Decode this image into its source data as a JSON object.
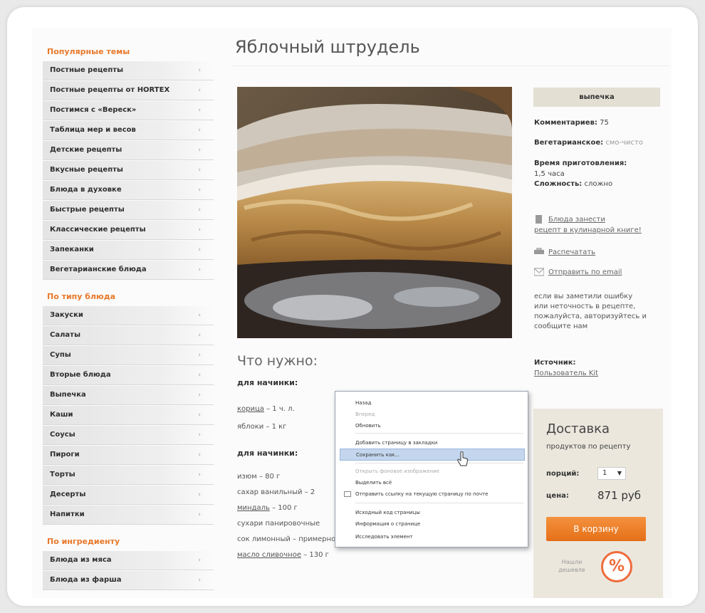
{
  "page": {
    "title": "Яблочный штрудель"
  },
  "sidebar": {
    "popular_heading": "Популярные темы",
    "popular_items": [
      "Постные рецепты",
      "Постные рецепты от HORTEX",
      "Постимся с «Вереск»",
      "Таблица мер и весов",
      "Детские рецепты",
      "Вкусные рецепты",
      "Блюда в духовке",
      "Быстрые рецепты",
      "Классические рецепты",
      "Запеканки",
      "Вегетарианские блюда"
    ],
    "dish_type_heading": "По типу блюда",
    "dish_type_items": [
      "Закуски",
      "Салаты",
      "Супы",
      "Вторые блюда",
      "Выпечка",
      "Каши",
      "Соусы",
      "Пироги",
      "Торты",
      "Десерты",
      "Напитки"
    ],
    "ingredient_heading": "По ингредиенту",
    "ingredient_items": [
      "Блюда из мяса",
      "Блюда из фарша"
    ],
    "arrow_icon": "chevron-right-icon"
  },
  "main": {
    "photo_alt": "apple-strudel-photo",
    "need_title": "Что нужно:",
    "filling1_heading": "для начинки:",
    "filling1_items": [
      {
        "link": "корица",
        "rest": " – 1 ч. л."
      },
      {
        "link": "",
        "rest": "яблоки – 1 кг"
      }
    ],
    "filling2_heading": "для начинки:",
    "filling2_items": [
      {
        "link": "",
        "rest": "изюм – 80 г"
      },
      {
        "link": "",
        "rest": "сахар ванильный – 2"
      },
      {
        "link": "миндаль",
        "rest": " – 100 г"
      },
      {
        "link": "",
        "rest": "сухари панировочные"
      },
      {
        "link": "",
        "rest": "сок лимонный – примерно 3-4 ст. л."
      },
      {
        "link": "масло сливочное",
        "rest": " – 130 г"
      }
    ]
  },
  "right": {
    "category_button": "выпечка",
    "comments_label": "Комментариев:",
    "comments_value": "75",
    "vegetarian_label": "Вегетарианское:",
    "vegetarian_value": "смо-чисто",
    "time_label": "Время приготовления:",
    "time_value": "1,5 часа",
    "difficulty_label": "Сложность:",
    "difficulty_value": "сложно",
    "links": [
      "Блюда занести",
      "рецепт в кулинарной книге!",
      "Распечатать",
      "Отправить по email"
    ],
    "error_note_lines": [
      "если вы заметили ошибку",
      "или неточность в рецепте,",
      "пожалуйста, авторизуйтесь и",
      "сообщите нам"
    ],
    "source_label": "Источник:",
    "source_value": "Пользователь Kit"
  },
  "delivery": {
    "title": "Доставка",
    "subtitle": "продуктов по рецепту",
    "portions_label": "порций:",
    "portions_value": "1",
    "price_label": "цена:",
    "price_value": "871 руб",
    "cart_button": "В корзину",
    "cheaper_text": "Нашли дешевле",
    "percent_symbol": "%",
    "accent_color": "#e8782a"
  },
  "context_menu": {
    "items": [
      {
        "label": "Назад",
        "state": "normal"
      },
      {
        "label": "Вперед",
        "state": "disabled"
      },
      {
        "label": "Обновить",
        "state": "normal"
      },
      {
        "label": "Добавить страницу в закладки",
        "state": "normal"
      },
      {
        "label": "Сохранить как...",
        "state": "highlighted"
      },
      {
        "label": "Открыть фоновое изображение",
        "state": "disabled"
      },
      {
        "label": "Выделить всё",
        "state": "normal"
      },
      {
        "label": "Отправить ссылку на текущую страницу по почте",
        "state": "normal"
      },
      {
        "label": "Исходный код страницы",
        "state": "normal"
      },
      {
        "label": "Информация о странице",
        "state": "normal"
      },
      {
        "label": "Исследовать элемент",
        "state": "normal"
      }
    ]
  }
}
